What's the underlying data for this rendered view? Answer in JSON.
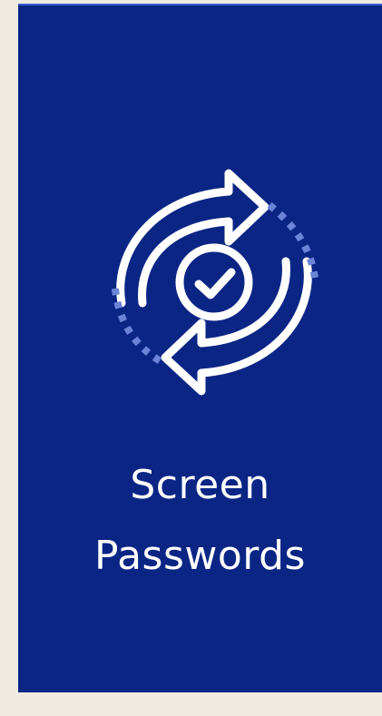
{
  "card": {
    "icon": "sync-check-icon",
    "title_line1": "Screen",
    "title_line2": "Passwords"
  },
  "colors": {
    "background": "#0b2585",
    "foreground": "#ffffff",
    "accent_dots": "#6b83d8",
    "page": "#efebe2"
  }
}
